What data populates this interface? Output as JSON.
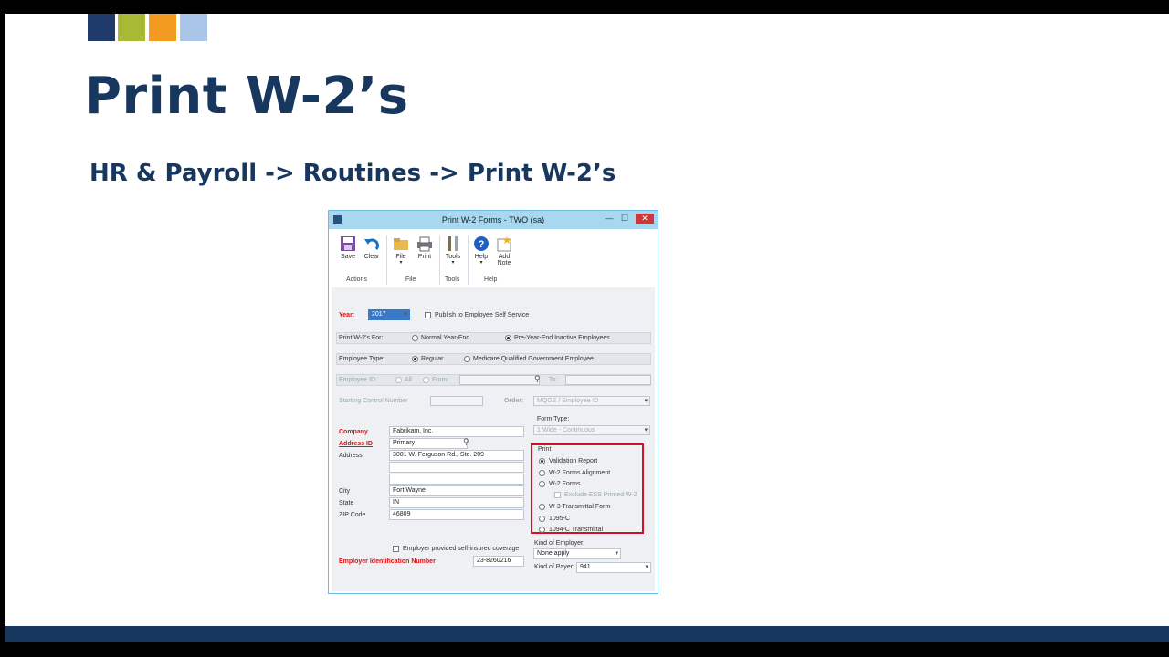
{
  "brand_colors": [
    "#1f3b6b",
    "#a8b935",
    "#f29b20",
    "#a9c6e8"
  ],
  "slide": {
    "title": "Print W-2’s",
    "subtitle": "HR & Payroll -> Routines -> Print W-2’s"
  },
  "window": {
    "title": "Print W-2 Forms  -  TWO (sa)",
    "controls": {
      "minimize": "—",
      "maximize": "☐",
      "close": "✕"
    }
  },
  "ribbon": {
    "buttons": [
      {
        "label": "Save",
        "icon": "save-icon"
      },
      {
        "label": "Clear",
        "icon": "undo-icon"
      },
      {
        "label": "File",
        "icon": "folder-icon"
      },
      {
        "label": "Print",
        "icon": "printer-icon"
      },
      {
        "label": "Tools",
        "icon": "tools-icon"
      },
      {
        "label": "Help",
        "icon": "help-icon"
      },
      {
        "label": "Add",
        "label2": "Note",
        "icon": "note-icon"
      }
    ],
    "groups": [
      "Actions",
      "File",
      "Tools",
      "Help"
    ]
  },
  "form": {
    "year_label": "Year:",
    "year_value": "2017",
    "publish_ess": "Publish to Employee Self Service",
    "print_for_label": "Print W-2’s For:",
    "print_for_options": [
      "Normal Year-End",
      "Pre-Year-End Inactive Employees"
    ],
    "employee_type_label": "Employee Type:",
    "employee_type_options": [
      "Regular",
      "Medicare Qualified Government Employee"
    ],
    "employee_id_label": "Employee ID:",
    "employee_id_options": [
      "All",
      "From:"
    ],
    "to_label": "To:",
    "starting_control_label": "Starting Control Number",
    "order_label": "Order:",
    "order_value": "MQGE / Employee ID",
    "form_type_label": "Form Type:",
    "form_type_value": "1 Wide - Continuous",
    "company_label": "Company",
    "company_value": "Fabrikam, Inc.",
    "address_id_label": "Address ID",
    "address_id_value": "Primary",
    "address_label": "Address",
    "address_value": "3001 W. Ferguson Rd., Ste. 209",
    "city_label": "City",
    "city_value": "Fort Wayne",
    "state_label": "State",
    "state_value": "IN",
    "zip_label": "ZIP Code",
    "zip_value": "46809",
    "print_group_label": "Print",
    "print_options": [
      "Validation Report",
      "W-2 Forms Alignment",
      "W-2 Forms",
      "Exclude ESS Printed W-2",
      "W-3 Transmittal Form",
      "1095-C",
      "1094-C Transmittal"
    ],
    "self_insured_label": "Employer provided self-insured coverage",
    "ein_label": "Employer Identification Number",
    "ein_value": "23-8260216",
    "kind_employer_label": "Kind of Employer:",
    "kind_employer_value": "None apply",
    "kind_payer_label": "Kind of Payer:",
    "kind_payer_value": "941"
  }
}
